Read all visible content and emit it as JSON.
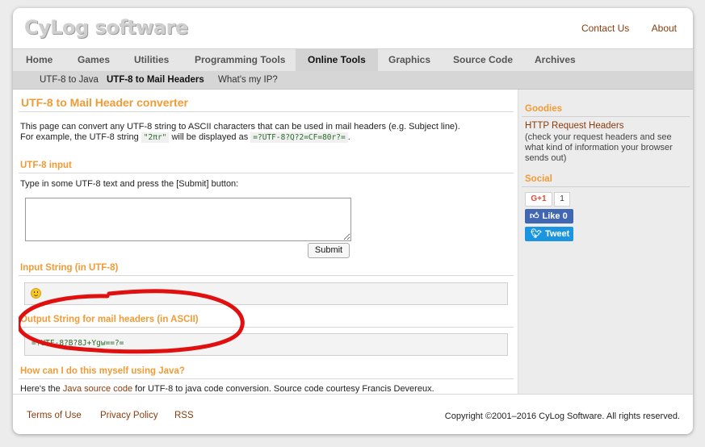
{
  "header": {
    "logo": "CyLog software",
    "links": [
      "Contact Us",
      "About"
    ]
  },
  "nav": {
    "items": [
      "Home",
      "Games",
      "Utilities",
      "Programming Tools",
      "Online Tools",
      "Graphics",
      "Source Code",
      "Archives"
    ],
    "active": "Online Tools"
  },
  "subnav": {
    "items": [
      "UTF-8 to Java",
      "UTF-8 to Mail Headers",
      "What's my IP?"
    ],
    "active": "UTF-8 to Mail Headers"
  },
  "main": {
    "title": "UTF-8 to Mail Header converter",
    "intro_line1": "This page can convert any UTF-8 string to ASCII characters that can be used in mail headers (e.g. Subject line).",
    "intro_line2_a": "For example, the UTF-8 string",
    "example_input": "\"2πr\"",
    "intro_line2_b": "will be displayed as",
    "example_output": "=?UTF-8?Q?2=CF=80r?=",
    "intro_line2_c": ".",
    "input_heading": "UTF-8 input",
    "input_instructions": "Type in some UTF-8 text and press the [Submit] button:",
    "textarea_value": "",
    "submit_label": "Submit",
    "input_string_heading": "Input String (in UTF-8)",
    "input_string_value": "grinning-face-emoji",
    "output_heading": "Output String for mail headers (in ASCII)",
    "output_value": "=?UTF-8?B?8J+Ygw==?=",
    "java_heading": "How can I do this myself using Java?",
    "java_text_a": "Here's the",
    "java_link": "Java source code",
    "java_text_b": "for UTF-8 to java code conversion. Source code courtesy Francis Devereux."
  },
  "sidebar": {
    "goodies_heading": "Goodies",
    "goodies_link": "HTTP Request Headers",
    "goodies_desc": "(check your request headers and see what kind of information your browser sends out)",
    "social_heading": "Social",
    "gplus_label": "G+1",
    "gplus_count": "1",
    "fb_label": "Like 0",
    "tw_label": "Tweet"
  },
  "footer": {
    "links": [
      "Terms of Use",
      "Privacy Policy",
      "RSS"
    ],
    "copyright": "Copyright ©2001–2016 CyLog Software. All rights reserved."
  },
  "colors": {
    "accent": "#f29b35",
    "link": "#8a3b0c",
    "annotation": "#e01010"
  }
}
